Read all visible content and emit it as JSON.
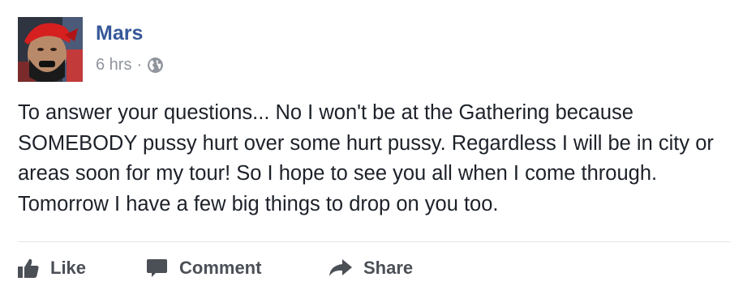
{
  "post": {
    "author": "Mars",
    "time": "6 hrs",
    "separator": "·",
    "privacy_icon": "globe-icon",
    "text": "To answer your questions... No I won't be at the Gathering because SOMEBODY pussy hurt over some hurt pussy. Regardless I will be in city or areas soon for my tour! So I hope to see you all when I come through. Tomorrow I have a few big things to drop on you too."
  },
  "actions": {
    "like_label": "Like",
    "comment_label": "Comment",
    "share_label": "Share",
    "like_icon": "thumbs-up-icon",
    "comment_icon": "speech-bubble-icon",
    "share_icon": "share-arrow-icon"
  },
  "colors": {
    "author_link": "#365899",
    "meta_gray": "#90949c",
    "body_text": "#1d2129",
    "action_text": "#4b4f56",
    "divider": "#e5e5e5"
  }
}
